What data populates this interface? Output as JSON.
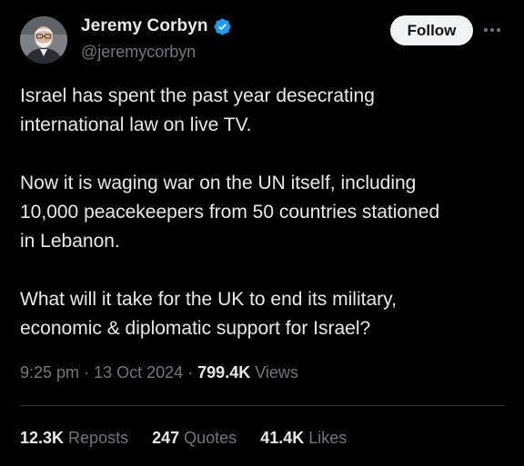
{
  "author": {
    "display_name": "Jeremy Corbyn",
    "handle": "@jeremycorbyn",
    "verified": true,
    "avatar_icon": "profile-photo"
  },
  "actions": {
    "follow_label": "Follow",
    "more_icon": "ellipsis-icon"
  },
  "tweet": {
    "paragraphs": [
      "Israel has spent the past year desecrating\ninternational law on live TV.",
      "Now it is waging war on the UN itself, including\n10,000 peacekeepers from 50 countries stationed\nin Lebanon.",
      "What will it take for the UK to end its military,\neconomic & diplomatic support for Israel?"
    ],
    "time": "9:25 pm",
    "date": "13 Oct 2024",
    "views_count": "799.4K",
    "views_label": "Views"
  },
  "stats": {
    "reposts_count": "12.3K",
    "reposts_label": "Reposts",
    "quotes_count": "247",
    "quotes_label": "Quotes",
    "likes_count": "41.4K",
    "likes_label": "Likes"
  },
  "colors": {
    "background": "#000000",
    "text_primary": "#e7e9ea",
    "text_secondary": "#71767b",
    "verified_blue": "#1d9bf0",
    "follow_bg": "#eff3f4",
    "divider": "#2f3336"
  }
}
